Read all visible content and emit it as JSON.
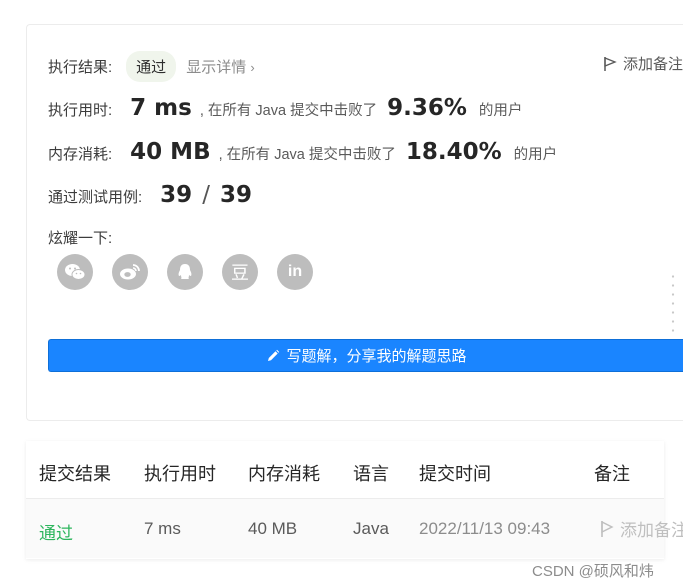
{
  "result": {
    "label": "执行结果:",
    "status": "通过",
    "detail_link": "显示详情",
    "note_button": "添加备注"
  },
  "runtime": {
    "label": "执行用时:",
    "value": "7 ms",
    "mid_text": ", 在所有 Java 提交中击败了",
    "percent": "9.36%",
    "tail": "的用户"
  },
  "memory": {
    "label": "内存消耗:",
    "value": "40 MB",
    "mid_text": ", 在所有 Java 提交中击败了",
    "percent": "18.40%",
    "tail": "的用户"
  },
  "tests": {
    "label": "通过测试用例:",
    "passed": "39",
    "sep": "/",
    "total": "39"
  },
  "share": {
    "label": "炫耀一下:",
    "icons": [
      "wechat-icon",
      "weibo-icon",
      "qq-icon",
      "douban-icon",
      "linkedin-icon"
    ],
    "douban_glyph": "豆",
    "linkedin_glyph": "in"
  },
  "solution_button": "写题解，分享我的解题思路",
  "table": {
    "headers": [
      "提交结果",
      "执行用时",
      "内存消耗",
      "语言",
      "提交时间",
      "备注"
    ],
    "row": {
      "result": "通过",
      "runtime": "7 ms",
      "memory": "40 MB",
      "language": "Java",
      "time": "2022/11/13 09:43",
      "note": "添加备注"
    }
  },
  "watermark": "CSDN @硕风和炜",
  "colors": {
    "accent": "#1a85ff",
    "success": "#2db55d",
    "icon_gray": "#bdbdbd"
  }
}
